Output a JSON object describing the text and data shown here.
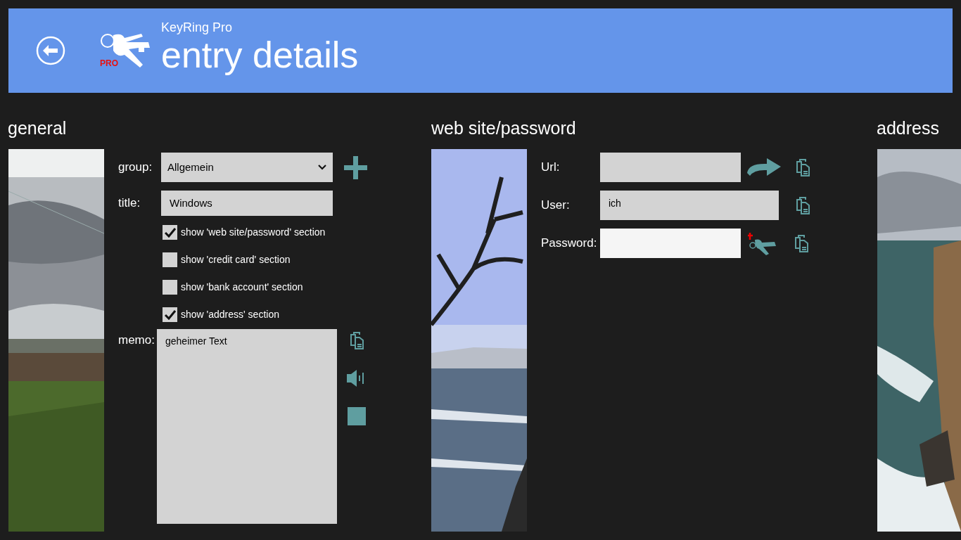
{
  "header": {
    "app_name": "KeyRing Pro",
    "page_title": "entry details",
    "logo_badge": "PRO"
  },
  "sections": [
    {
      "title": "general"
    },
    {
      "title": "web site/password"
    },
    {
      "title": "address"
    }
  ],
  "general": {
    "group": {
      "label": "group:",
      "value": "Allgemein"
    },
    "title_field": {
      "label": "title:",
      "value": "Windows"
    },
    "checkboxes": [
      {
        "label": "show 'web site/password' section",
        "checked": true
      },
      {
        "label": "show 'credit card' section",
        "checked": false
      },
      {
        "label": "show 'bank account' section",
        "checked": false
      },
      {
        "label": "show 'address' section",
        "checked": true
      }
    ],
    "memo": {
      "label": "memo:",
      "value": "geheimer Text"
    }
  },
  "web": {
    "fields": [
      {
        "kind": "url",
        "label": "Url:"
      },
      {
        "kind": "user",
        "label": "User:",
        "value": "ich"
      },
      {
        "kind": "password",
        "label": "Password:"
      }
    ]
  }
}
